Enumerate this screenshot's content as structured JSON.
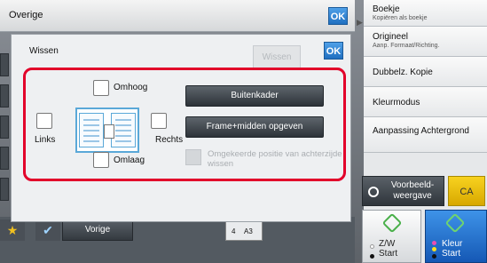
{
  "top_bar": {
    "title": "Overige",
    "ok_label": "OK"
  },
  "right_panel": {
    "items": [
      {
        "label": "Boekje",
        "sub": "Kopiëren als boekje"
      },
      {
        "label": "Origineel",
        "sub": "Aanp. Formaat/Richting."
      },
      {
        "label": "Dubbelz. Kopie",
        "sub": ""
      },
      {
        "label": "Kleurmodus",
        "sub": ""
      },
      {
        "label": "Aanpassing Achtergrond",
        "sub": ""
      }
    ],
    "preview_label": "Voorbeeld-\nweergave",
    "ca_label": "CA",
    "start_bw_label": "Z/W\nStart",
    "start_color_label": "Kleur\nStart"
  },
  "dialog": {
    "title": "Wissen",
    "wissen_button": "Wissen",
    "ok_label": "OK",
    "top_label": "Omhoog",
    "bottom_label": "Omlaag",
    "left_label": "Links",
    "right_label": "Rechts",
    "outer_frame_button": "Buitenkader",
    "frame_center_button": "Frame+midden opgeven",
    "reverse_back_label": "Omgekeerde positie van achterzijde wissen"
  },
  "bottom_bar": {
    "back_label": "Vorige",
    "paper_tray": "4",
    "paper_size": "A3"
  },
  "colors": {
    "accent_red": "#e2002a",
    "ok_blue": "#1f6fc0",
    "ca_yellow": "#f8d21f",
    "start_color_blue": "#1558b5"
  }
}
